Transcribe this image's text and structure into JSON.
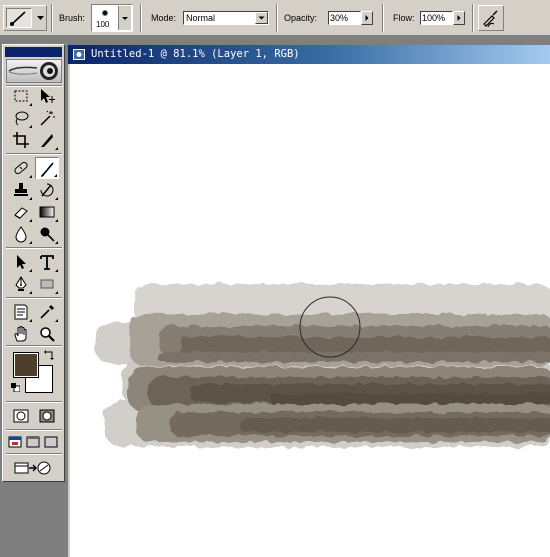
{
  "options_bar": {
    "brush_label": "Brush:",
    "brush_size": "100",
    "mode_label": "Mode:",
    "mode_value": "Normal",
    "opacity_label": "Opacity:",
    "opacity_value": "30%",
    "flow_label": "Flow:",
    "flow_value": "100%"
  },
  "document": {
    "title": "Untitled-1 @ 81.1% (Layer 1, RGB)",
    "zoom": "81.1%",
    "layer": "Layer 1",
    "color_mode": "RGB"
  },
  "toolbox": {
    "selected_tool": "brush-tool",
    "foreground_color": "#4e3f2d",
    "background_color": "#ffffff",
    "tools": [
      "marquee-tool",
      "move-tool",
      "lasso-tool",
      "magic-wand-tool",
      "crop-tool",
      "slice-tool",
      "healing-brush-tool",
      "brush-tool",
      "clone-stamp-tool",
      "history-brush-tool",
      "eraser-tool",
      "gradient-tool",
      "blur-tool",
      "dodge-tool",
      "path-selection-tool",
      "type-tool",
      "pen-tool",
      "rectangle-tool",
      "notes-tool",
      "eyedropper-tool",
      "hand-tool",
      "zoom-tool"
    ]
  },
  "colors": {
    "ui_face": "#d4d0c8",
    "titlebar_start": "#0a246a",
    "titlebar_end": "#a6caf0",
    "stroke_light": "#d6d3ce",
    "stroke_dark": "#5c5347"
  }
}
